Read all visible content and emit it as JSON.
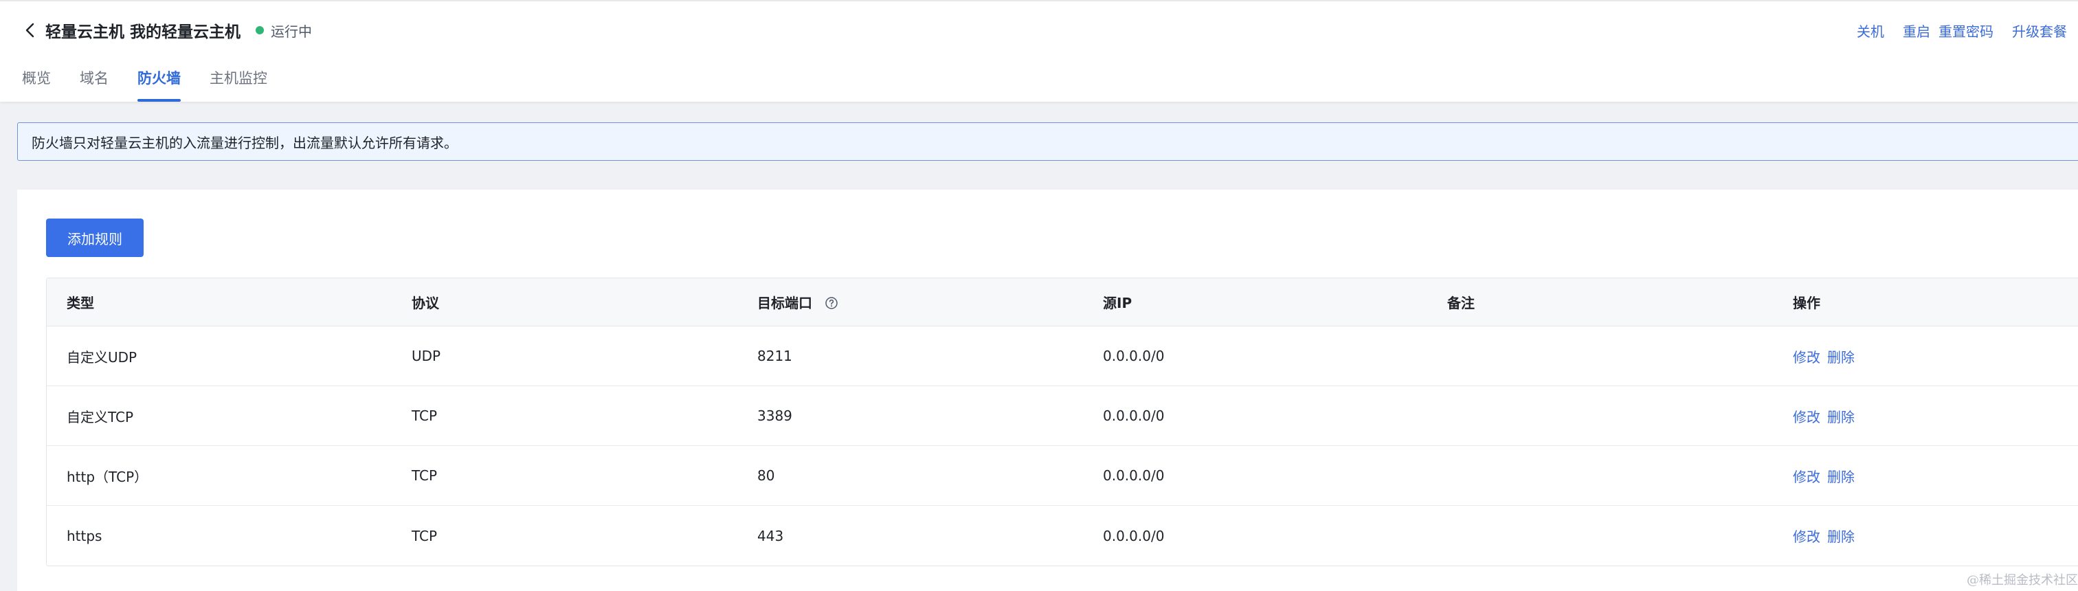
{
  "header": {
    "title": "轻量云主机 我的轻量云主机",
    "status": {
      "label": "运行中",
      "color": "#2fb576"
    },
    "back_icon": "chevron-left-icon",
    "actions": [
      "关机",
      "重启",
      "重置密码",
      "升级套餐"
    ]
  },
  "tabs": [
    {
      "label": "概览",
      "active": false
    },
    {
      "label": "域名",
      "active": false
    },
    {
      "label": "防火墙",
      "active": true
    },
    {
      "label": "主机监控",
      "active": false
    }
  ],
  "notice": {
    "text": "防火墙只对轻量云主机的入流量进行控制，出流量默认允许所有请求。"
  },
  "add_rule_button": "添加规则",
  "table": {
    "columns": [
      "类型",
      "协议",
      "目标端口",
      "源IP",
      "备注",
      "操作"
    ],
    "port_help_icon": "question-circle-icon",
    "rows": [
      {
        "type": "自定义UDP",
        "protocol": "UDP",
        "port": "8211",
        "source_ip": "0.0.0.0/0",
        "note": "",
        "edit": "修改",
        "delete": "删除"
      },
      {
        "type": "自定义TCP",
        "protocol": "TCP",
        "port": "3389",
        "source_ip": "0.0.0.0/0",
        "note": "",
        "edit": "修改",
        "delete": "删除"
      },
      {
        "type": "http（TCP）",
        "protocol": "TCP",
        "port": "80",
        "source_ip": "0.0.0.0/0",
        "note": "",
        "edit": "修改",
        "delete": "删除"
      },
      {
        "type": "https",
        "protocol": "TCP",
        "port": "443",
        "source_ip": "0.0.0.0/0",
        "note": "",
        "edit": "修改",
        "delete": "删除"
      }
    ]
  },
  "colors": {
    "accent": "#3970e8",
    "link": "#3c6cd9",
    "notice_border": "#6b93e0",
    "notice_bg": "#eff5ff"
  },
  "watermark": "@稀土掘金技术社区"
}
